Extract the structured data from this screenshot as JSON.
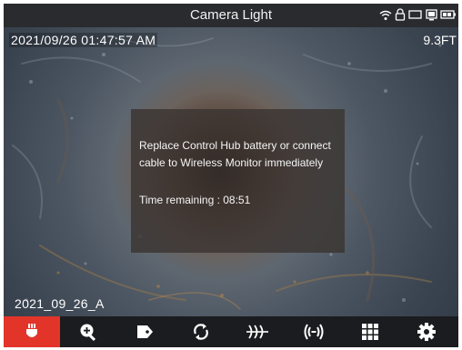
{
  "header": {
    "title": "Camera Light",
    "status_icons": [
      "wifi-icon",
      "lock-icon",
      "battery-outline-icon",
      "monitor-icon",
      "battery-icon"
    ]
  },
  "overlay": {
    "timestamp": "2021/09/26 01:47:57 AM",
    "distance": "9.3FT",
    "filename": "2021_09_26_A"
  },
  "dialog": {
    "line1": "Replace Control Hub battery or connect",
    "line2": "cable to Wireless Monitor immediately",
    "line3": "Time remaining : 08:51"
  },
  "toolbar": {
    "buttons": [
      "camera-light-icon",
      "zoom-in-icon",
      "tag-icon",
      "rotate-icon",
      "distance-counter-icon",
      "transmit-icon",
      "grid-icon",
      "settings-icon"
    ],
    "active": "camera-light-icon",
    "active_color": "#e3342a"
  }
}
